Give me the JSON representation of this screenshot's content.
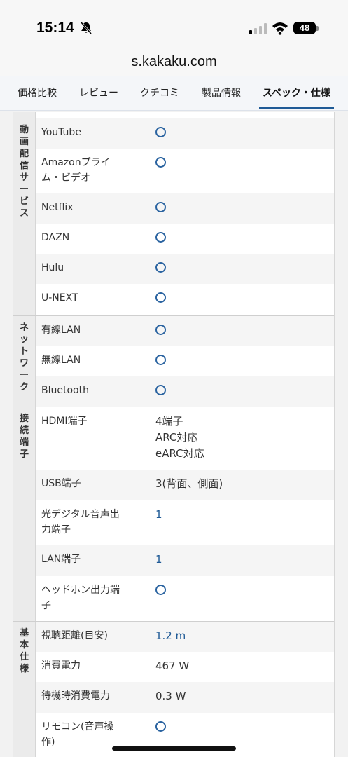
{
  "status": {
    "time": "15:14",
    "battery": "48"
  },
  "browser": {
    "url": "s.kakaku.com"
  },
  "tabs": [
    {
      "label": "価格比較"
    },
    {
      "label": "レビュー"
    },
    {
      "label": "クチコミ"
    },
    {
      "label": "製品情報"
    },
    {
      "label": "スペック・仕様",
      "active": true
    }
  ],
  "spec": {
    "video": {
      "category": [
        "動",
        "画",
        "配",
        "信",
        "サ",
        "ー",
        "ビ",
        "ス"
      ],
      "rows": [
        {
          "label": "YouTube",
          "value": "○"
        },
        {
          "label": "Amazonプライム・ビデオ",
          "value": "○"
        },
        {
          "label": "Netflix",
          "value": "○"
        },
        {
          "label": "DAZN",
          "value": "○"
        },
        {
          "label": "Hulu",
          "value": "○"
        },
        {
          "label": "U-NEXT",
          "value": "○"
        }
      ]
    },
    "network": {
      "category": [
        "ネ",
        "ッ",
        "ト",
        "ワ",
        "ー",
        "ク"
      ],
      "rows": [
        {
          "label": "有線LAN",
          "value": "○"
        },
        {
          "label": "無線LAN",
          "value": "○"
        },
        {
          "label": "Bluetooth",
          "value": "○"
        }
      ]
    },
    "ports": {
      "category": [
        "接",
        "続",
        "端",
        "子"
      ],
      "rows": [
        {
          "label": "HDMI端子",
          "value": "4端子",
          "value2": "ARC対応",
          "value3": "eARC対応"
        },
        {
          "label": "USB端子",
          "value": "3(背面、側面)"
        },
        {
          "label": "光デジタル音声出力端子",
          "value": "1"
        },
        {
          "label": "LAN端子",
          "value": "1"
        },
        {
          "label": "ヘッドホン出力端子",
          "value": "○"
        }
      ]
    },
    "basic": {
      "category": [
        "基",
        "本",
        "仕",
        "様"
      ],
      "rows": [
        {
          "label": "視聴距離(目安)",
          "value": "1.2 m"
        },
        {
          "label": "消費電力",
          "value": "467 W"
        },
        {
          "label": "待機時消費電力",
          "value": "0.3 W"
        },
        {
          "label": "リモコン(音声操作)",
          "value": "○"
        }
      ]
    }
  },
  "colors": {
    "accent": "#1f5a96",
    "circle": "#2a63a0"
  }
}
